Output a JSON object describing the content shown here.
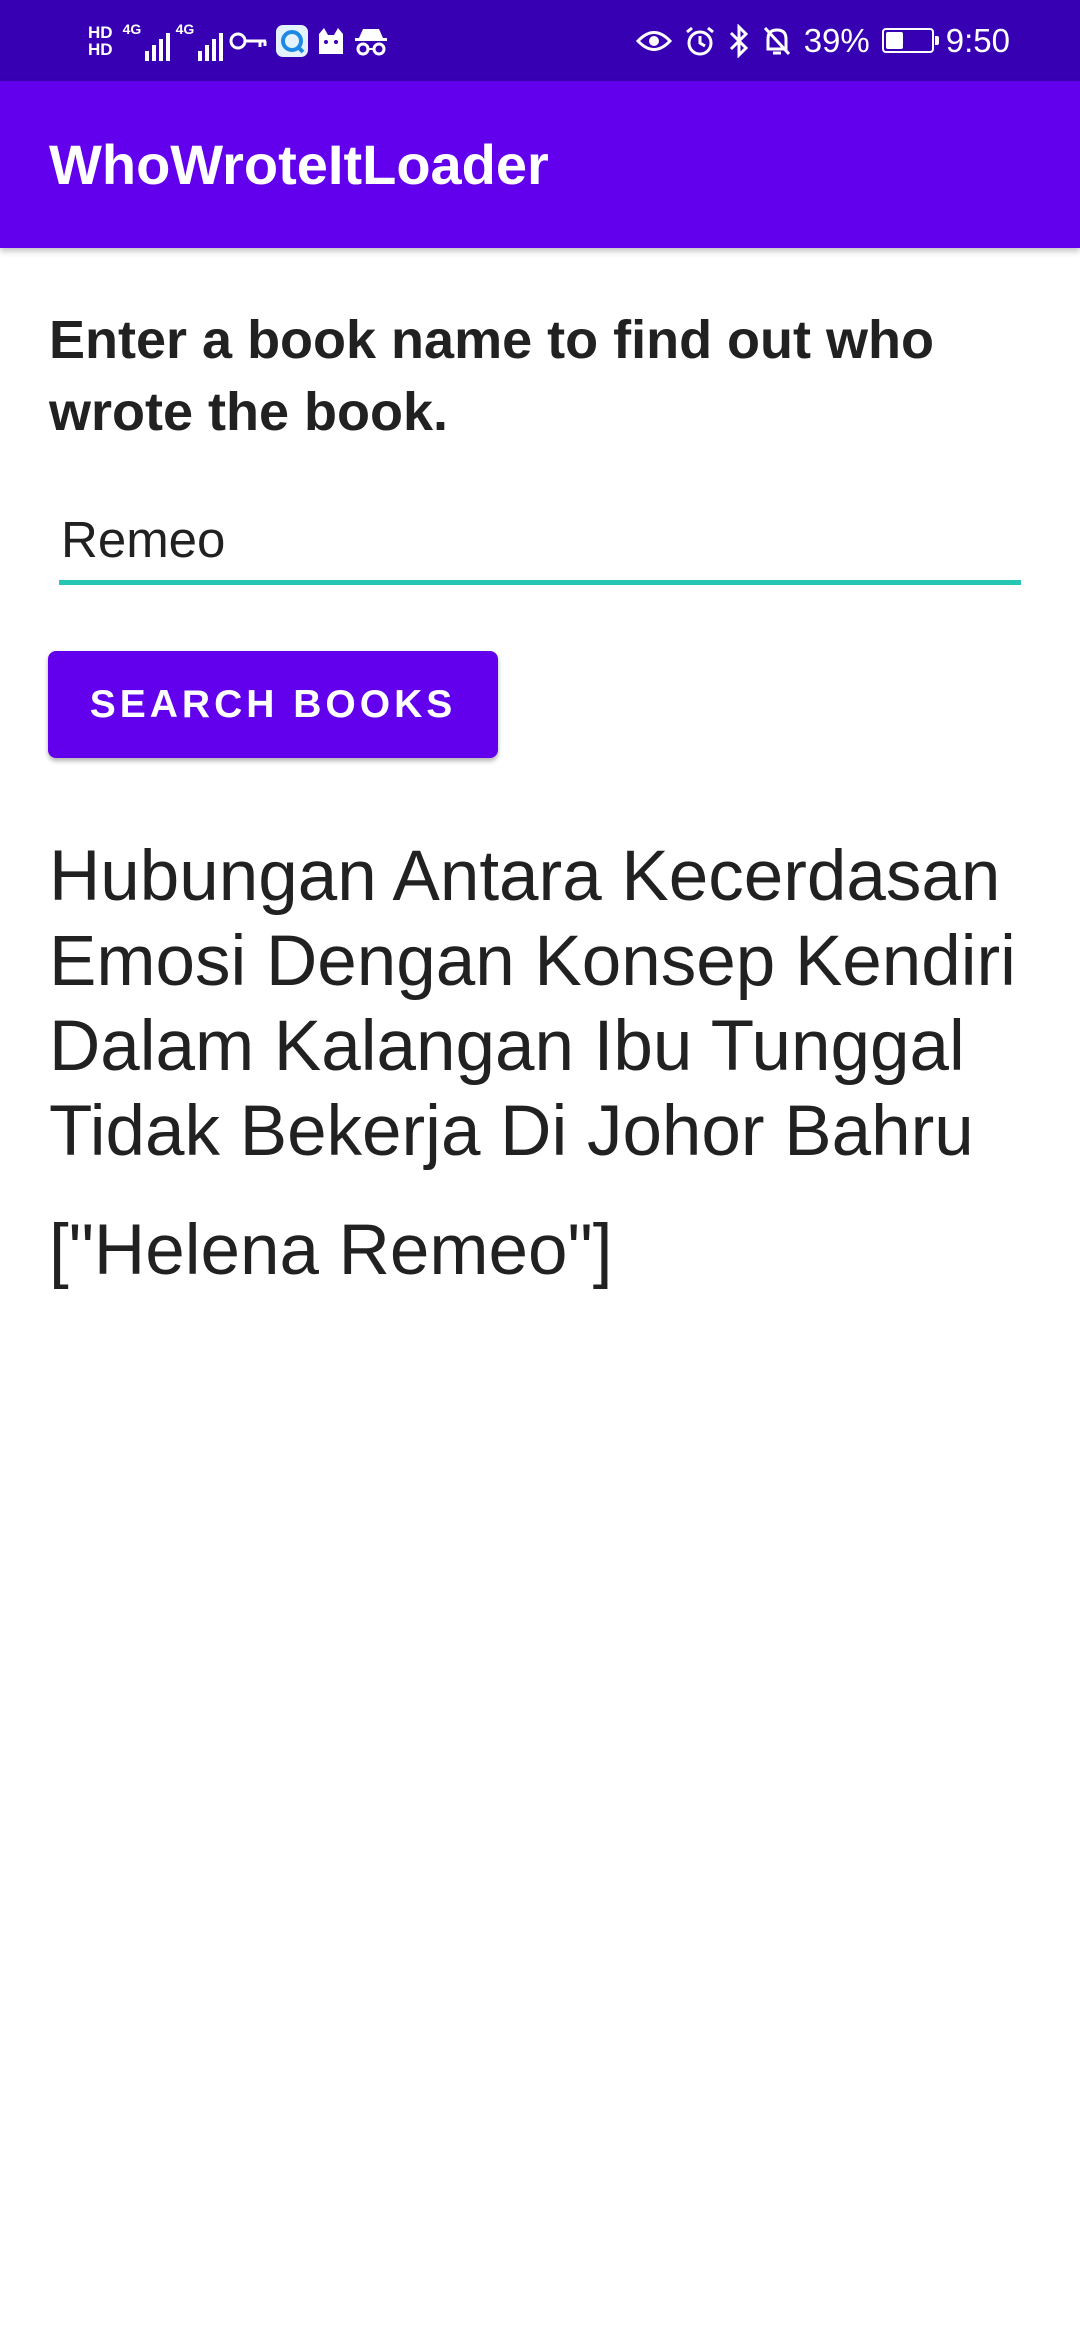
{
  "status_bar": {
    "hd_1": "HD",
    "hd_2": "HD",
    "sim1_network": "4G",
    "sim2_network": "4G",
    "battery_percent": "39%",
    "battery_level": 0.39,
    "time": "9:50",
    "icons": [
      "hd-icon",
      "signal-icon",
      "signal-icon",
      "key-icon",
      "app-icon",
      "cat-icon",
      "incognito-icon",
      "eye-icon",
      "alarm-icon",
      "bluetooth-icon",
      "bell-off-icon",
      "battery-charging-icon"
    ]
  },
  "app_bar": {
    "title": "WhoWroteItLoader",
    "color": "#6200ee"
  },
  "main": {
    "instructions": "Enter a book name to find out who wrote the book.",
    "book_input": {
      "value": "Remeo",
      "underline_color": "#26c6b4"
    },
    "search_button_label": "SEARCH BOOKS",
    "result_title": "Hubungan Antara Kecerdasan Emosi Dengan Konsep Kendiri Dalam Kalangan Ibu Tunggal Tidak Bekerja Di Johor Bahru",
    "result_author": "[\"Helena Remeo\"]"
  }
}
